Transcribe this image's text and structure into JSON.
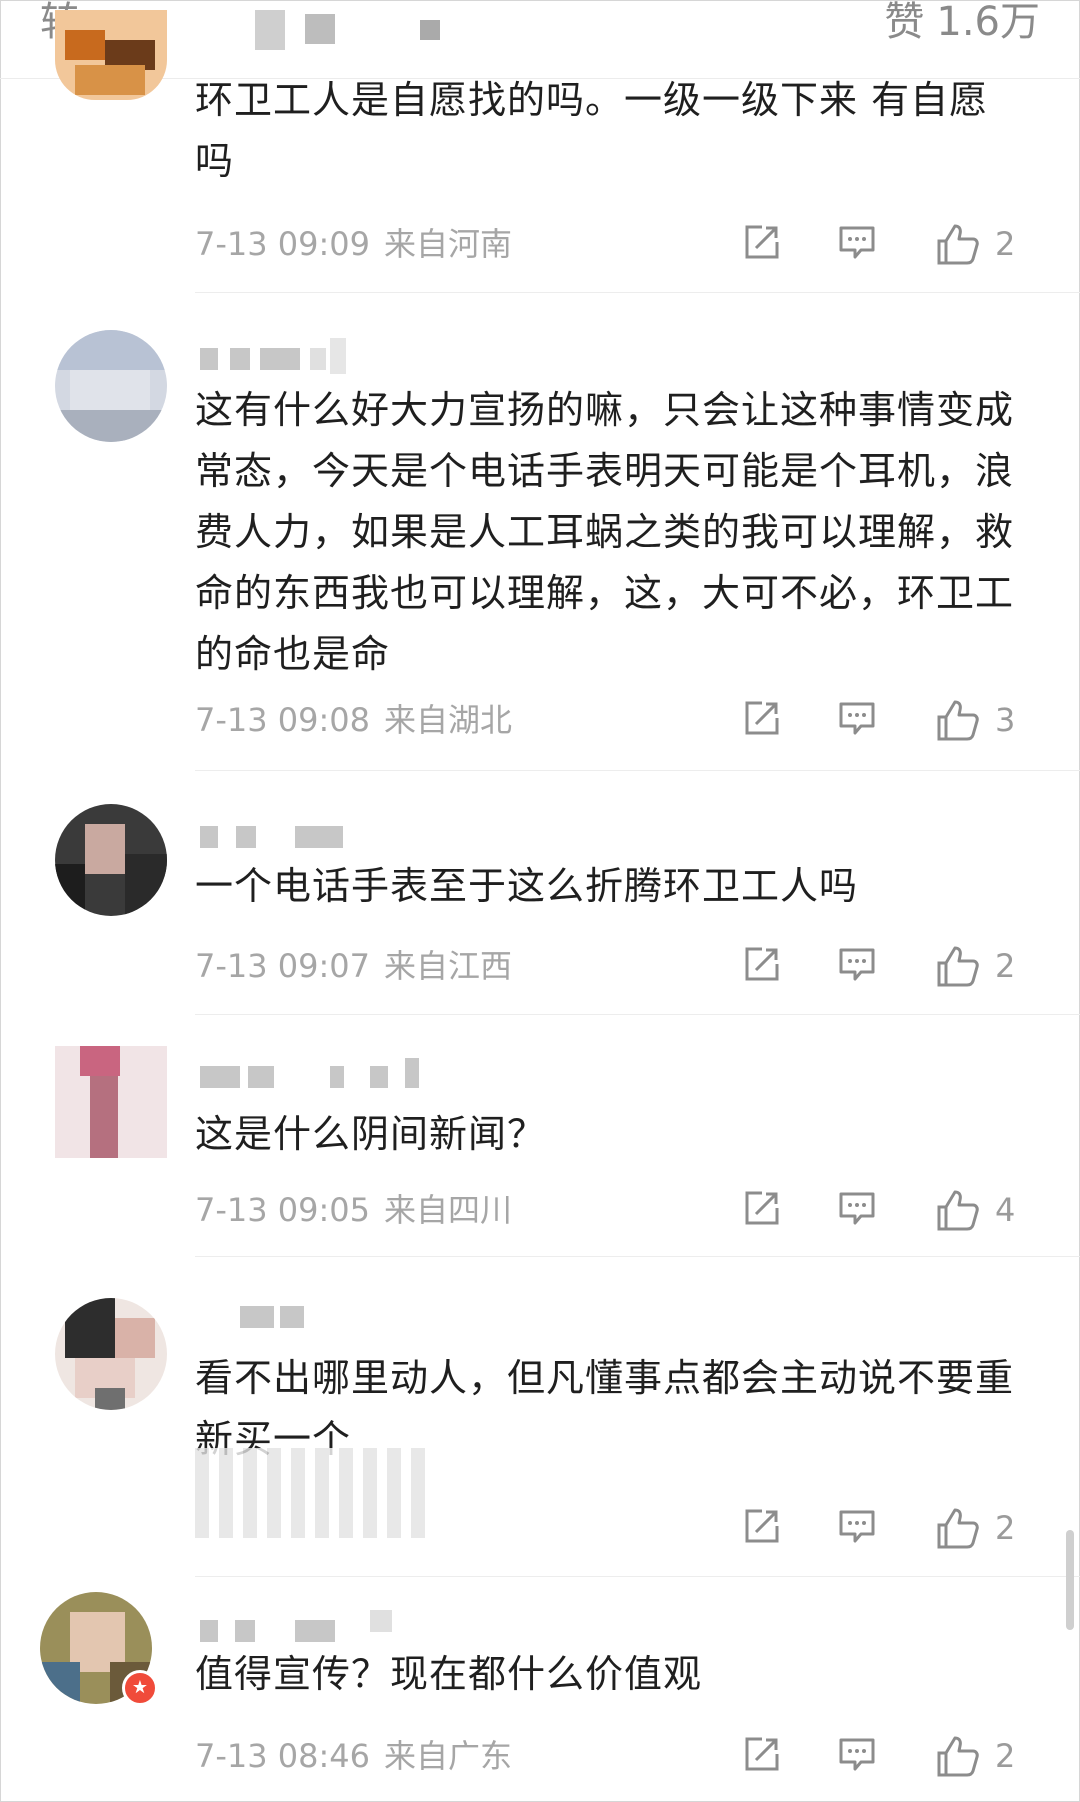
{
  "header": {
    "repost_label": "转",
    "like_label": "赞",
    "like_count": "1.6万"
  },
  "comments": [
    {
      "text": "环卫工人是自愿找的吗。一级一级下来 有自愿吗",
      "date": "7-13 09:09",
      "location": "来自河南",
      "likes": "2"
    },
    {
      "text": "这有什么好大力宣扬的嘛，只会让这种事情变成常态，今天是个电话手表明天可能是个耳机，浪费人力，如果是人工耳蜗之类的我可以理解，救命的东西我也可以理解，这，大可不必，环卫工的命也是命",
      "date": "7-13 09:08",
      "location": "来自湖北",
      "likes": "3"
    },
    {
      "text": "一个电话手表至于这么折腾环卫工人吗",
      "date": "7-13 09:07",
      "location": "来自江西",
      "likes": "2"
    },
    {
      "text": "这是什么阴间新闻？",
      "date": "7-13 09:05",
      "location": "来自四川",
      "likes": "4"
    },
    {
      "text": "看不出哪里动人，但凡懂事点都会主动说不要重新买一个",
      "date": "",
      "location": "",
      "likes": "2"
    },
    {
      "text": "值得宣传？现在都什么价值观",
      "date": "7-13 08:46",
      "location": "来自广东",
      "likes": "2"
    }
  ],
  "colors": {
    "meta_gray": "#a6a6a6",
    "icon_gray": "#8c8c8c",
    "text": "#1f1f1f"
  },
  "icons": [
    "share-icon",
    "comment-icon",
    "thumbs-up-icon"
  ]
}
